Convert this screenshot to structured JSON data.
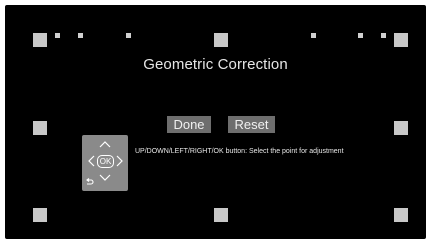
{
  "screen": {
    "title": "Geometric Correction",
    "buttons": {
      "done_label": "Done",
      "reset_label": "Reset"
    },
    "help_text": "UP/DOWN/LEFT/RIGHT/OK button: Select the point for adjustment",
    "remote_pad": {
      "ok_label": "OK",
      "icons": [
        "arrow-up-icon",
        "arrow-down-icon",
        "arrow-left-icon",
        "arrow-right-icon",
        "back-icon"
      ]
    }
  },
  "colors": {
    "background": "#000000",
    "point": "#c8c8c8",
    "button": "#6e6e6e",
    "pad": "#8a8a8a",
    "text": "#e6e6e6"
  }
}
